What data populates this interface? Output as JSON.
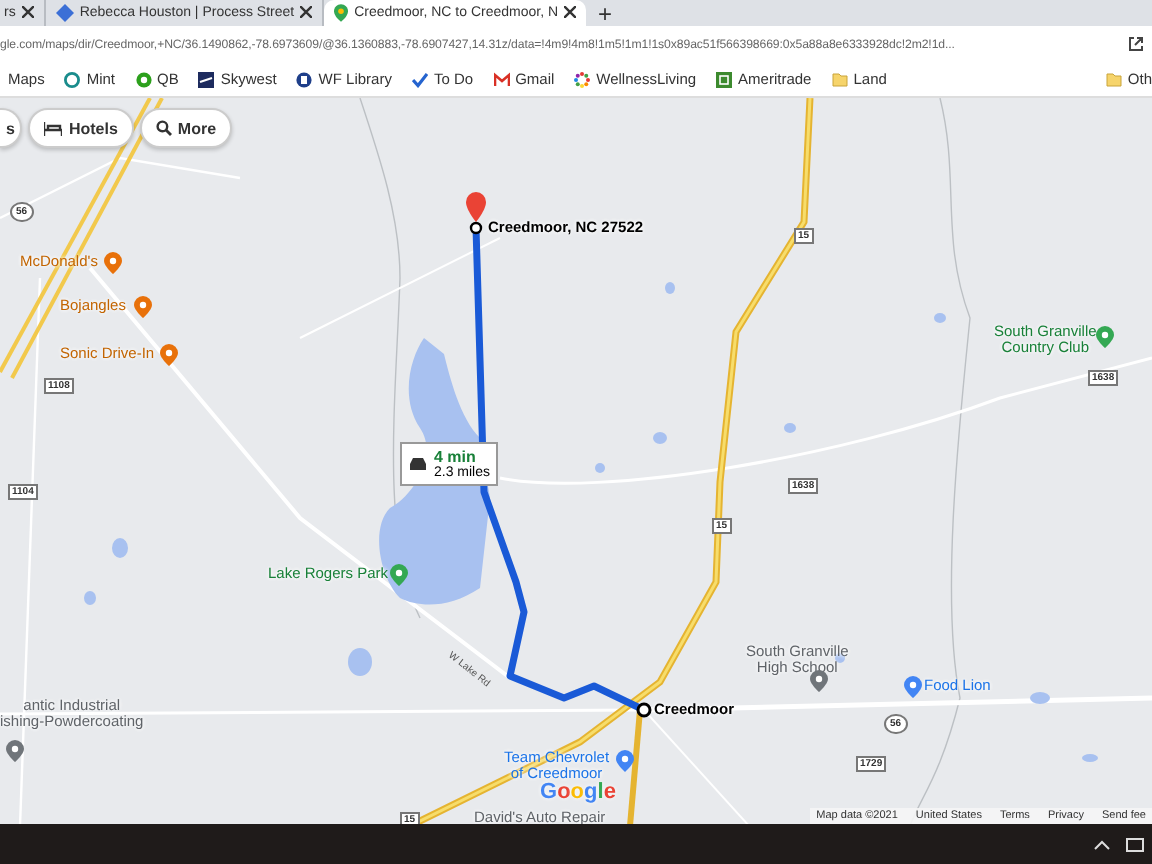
{
  "browser": {
    "tabs": [
      {
        "title": "rs",
        "selected": false
      },
      {
        "title": "Rebecca Houston | Process Street",
        "selected": false
      },
      {
        "title": "Creedmoor, NC to Creedmoor, N",
        "selected": true
      }
    ],
    "new_tab": "+",
    "address": "gle.com/maps/dir/Creedmoor,+NC/36.1490862,-78.6973609/@36.1360883,-78.6907427,14.31z/data=!4m9!4m8!1m5!1m1!1s0x89ac51f566398669:0x5a88a8e6333928dc!2m2!1d...",
    "bookmarks": [
      {
        "kind": "maps",
        "label": "Maps"
      },
      {
        "kind": "mint",
        "label": "Mint"
      },
      {
        "kind": "qb",
        "label": "QB"
      },
      {
        "kind": "skywest",
        "label": "Skywest"
      },
      {
        "kind": "library",
        "label": "WF Library"
      },
      {
        "kind": "todo",
        "label": "To Do"
      },
      {
        "kind": "gmail",
        "label": "Gmail"
      },
      {
        "kind": "wellness",
        "label": "WellnessLiving"
      },
      {
        "kind": "ameritrade",
        "label": "Ameritrade"
      },
      {
        "kind": "folder",
        "label": "Land"
      }
    ],
    "other_bookmarks": "Oth"
  },
  "map": {
    "chips": [
      {
        "kind": "partial",
        "label": "s"
      },
      {
        "kind": "hotels",
        "label": "Hotels"
      },
      {
        "kind": "more",
        "label": "More"
      }
    ],
    "destination": "Creedmoor, NC 27522",
    "origin": "Creedmoor",
    "route": {
      "time": "4 min",
      "distance": "2.3 miles"
    },
    "places": [
      {
        "kind": "food",
        "lines": [
          "McDonald's"
        ]
      },
      {
        "kind": "food",
        "lines": [
          "Bojangles"
        ]
      },
      {
        "kind": "food",
        "lines": [
          "Sonic Drive-In"
        ]
      },
      {
        "kind": "park",
        "lines": [
          "Lake Rogers Park"
        ]
      },
      {
        "kind": "golf",
        "lines": [
          "South Granville",
          "Country Club"
        ]
      },
      {
        "kind": "school",
        "lines": [
          "South Granville",
          "High School"
        ]
      },
      {
        "kind": "shop",
        "lines": [
          "Food Lion"
        ]
      },
      {
        "kind": "other",
        "lines": [
          "antic Industrial",
          "ishing-Powdercoating"
        ]
      },
      {
        "kind": "shop",
        "lines": [
          "Team Chevrolet",
          "of Creedmoor"
        ]
      },
      {
        "kind": "none",
        "lines": [
          "David's Auto Repair"
        ]
      }
    ],
    "roads": [
      "W Lake Rd"
    ],
    "shields": [
      {
        "kind": "state",
        "number": "56"
      },
      {
        "kind": "secondary",
        "number": "1108"
      },
      {
        "kind": "secondary",
        "number": "1104"
      },
      {
        "kind": "us",
        "number": "15"
      },
      {
        "kind": "secondary",
        "number": "1638"
      },
      {
        "kind": "us",
        "number": "15"
      },
      {
        "kind": "secondary",
        "number": "1638"
      },
      {
        "kind": "state",
        "number": "56"
      },
      {
        "kind": "secondary",
        "number": "1729"
      },
      {
        "kind": "us",
        "number": "15"
      }
    ],
    "logo": "Google",
    "footer": [
      "Map data ©2021",
      "United States",
      "Terms",
      "Privacy",
      "Send fee"
    ]
  }
}
